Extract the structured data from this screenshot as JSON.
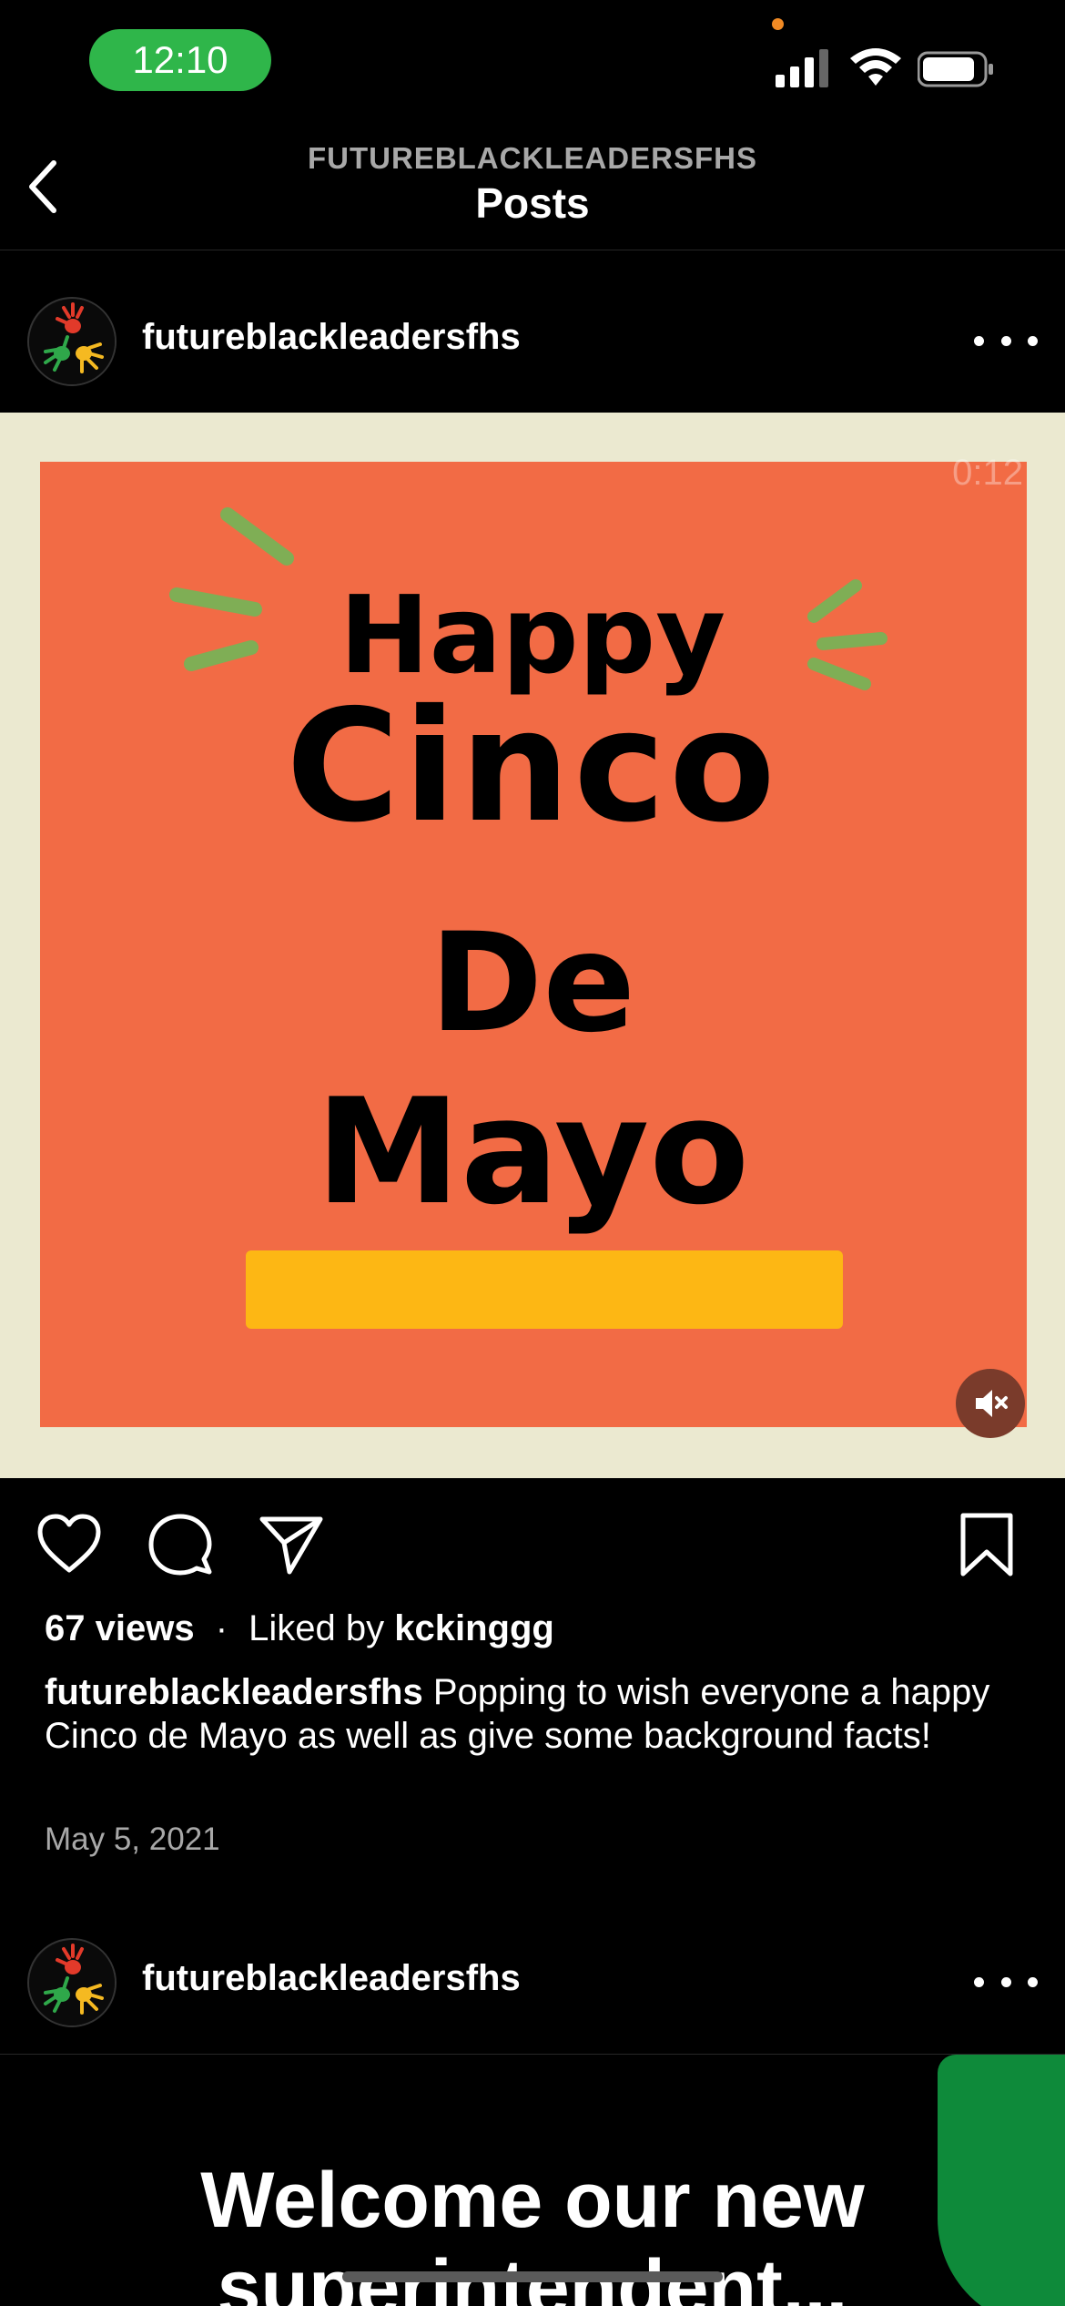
{
  "status_bar": {
    "time": "12:10"
  },
  "nav": {
    "subtitle": "FUTUREBLACKLEADERSFHS",
    "title": "Posts"
  },
  "post1": {
    "username": "futureblackleadersfhs",
    "video_time": "0:12",
    "image_text": {
      "line1": "Happy",
      "line2": "Cinco",
      "line3": "De",
      "line4": "Mayo"
    },
    "views": "67 views",
    "liked_by_prefix": "Liked by",
    "liked_by_user": "kckinggg",
    "caption_user": "futureblackleadersfhs",
    "caption_text": "Popping to wish everyone a happy Cinco de Mayo as well as give some background facts!",
    "date": "May 5, 2021"
  },
  "post2": {
    "username": "futureblackleadersfhs",
    "image_text": "Welcome our new superintendent..."
  },
  "colors": {
    "status_pill": "#2fb64a",
    "card_orange": "#f26b45",
    "card_bg": "#ebe9d0",
    "band_yellow": "#fdb714",
    "accent_green": "#0e8a3a"
  },
  "icons": [
    "back-chevron-icon",
    "heart-icon",
    "comment-icon",
    "share-icon",
    "bookmark-icon",
    "mute-icon",
    "more-icon"
  ]
}
